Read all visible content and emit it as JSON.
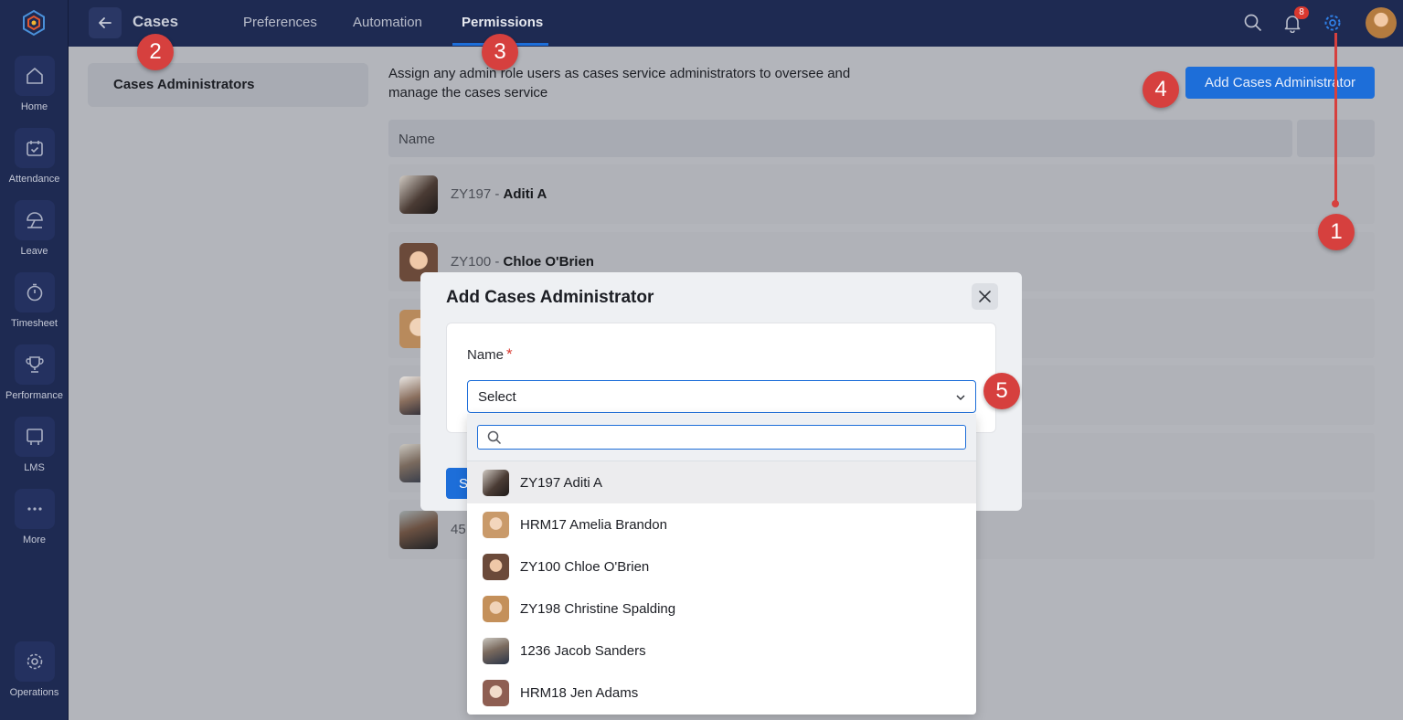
{
  "sidebar": {
    "items": [
      {
        "label": "Home",
        "icon": "home-icon"
      },
      {
        "label": "Attendance",
        "icon": "calendar-check-icon"
      },
      {
        "label": "Leave",
        "icon": "umbrella-icon"
      },
      {
        "label": "Timesheet",
        "icon": "stopwatch-icon"
      },
      {
        "label": "Performance",
        "icon": "trophy-icon"
      },
      {
        "label": "LMS",
        "icon": "course-icon"
      },
      {
        "label": "More",
        "icon": "more-dots-icon"
      },
      {
        "label": "Operations",
        "icon": "operations-gear-icon"
      }
    ]
  },
  "header": {
    "title": "Cases",
    "tabs": [
      {
        "label": "Preferences"
      },
      {
        "label": "Automation"
      },
      {
        "label": "Permissions",
        "active": true
      }
    ],
    "notification_count": "8"
  },
  "subnav": {
    "item": "Cases Administrators"
  },
  "main": {
    "description": "Assign any admin role users as cases service administrators to oversee and manage the cases service",
    "add_button": "Add Cases Administrator",
    "table": {
      "columns": [
        "Name"
      ],
      "rows": [
        {
          "id": "ZY197",
          "sep": " - ",
          "name": "Aditi A"
        },
        {
          "id": "ZY100",
          "sep": " - ",
          "name": "Chloe O'Brien"
        },
        {
          "id": "",
          "sep": "",
          "name": ""
        },
        {
          "id": "",
          "sep": "",
          "name": ""
        },
        {
          "id": "",
          "sep": "",
          "name": ""
        },
        {
          "id": "45",
          "sep": "",
          "name": ""
        }
      ]
    }
  },
  "modal": {
    "title": "Add Cases Administrator",
    "field_label": "Name",
    "required_mark": "*",
    "select_value": "Select",
    "submit_partial": "S",
    "search_placeholder": "",
    "options": [
      {
        "label": "ZY197 Aditi A"
      },
      {
        "label": "HRM17 Amelia Brandon"
      },
      {
        "label": "ZY100 Chloe O'Brien"
      },
      {
        "label": "ZY198 Christine Spalding"
      },
      {
        "label": "1236 Jacob Sanders"
      },
      {
        "label": "HRM18 Jen Adams"
      }
    ]
  },
  "markers": [
    "1",
    "2",
    "3",
    "4",
    "5"
  ],
  "colors": {
    "navy": "#1e2a52",
    "accent_blue": "#1d6ed9",
    "marker_red": "#d6403e"
  }
}
